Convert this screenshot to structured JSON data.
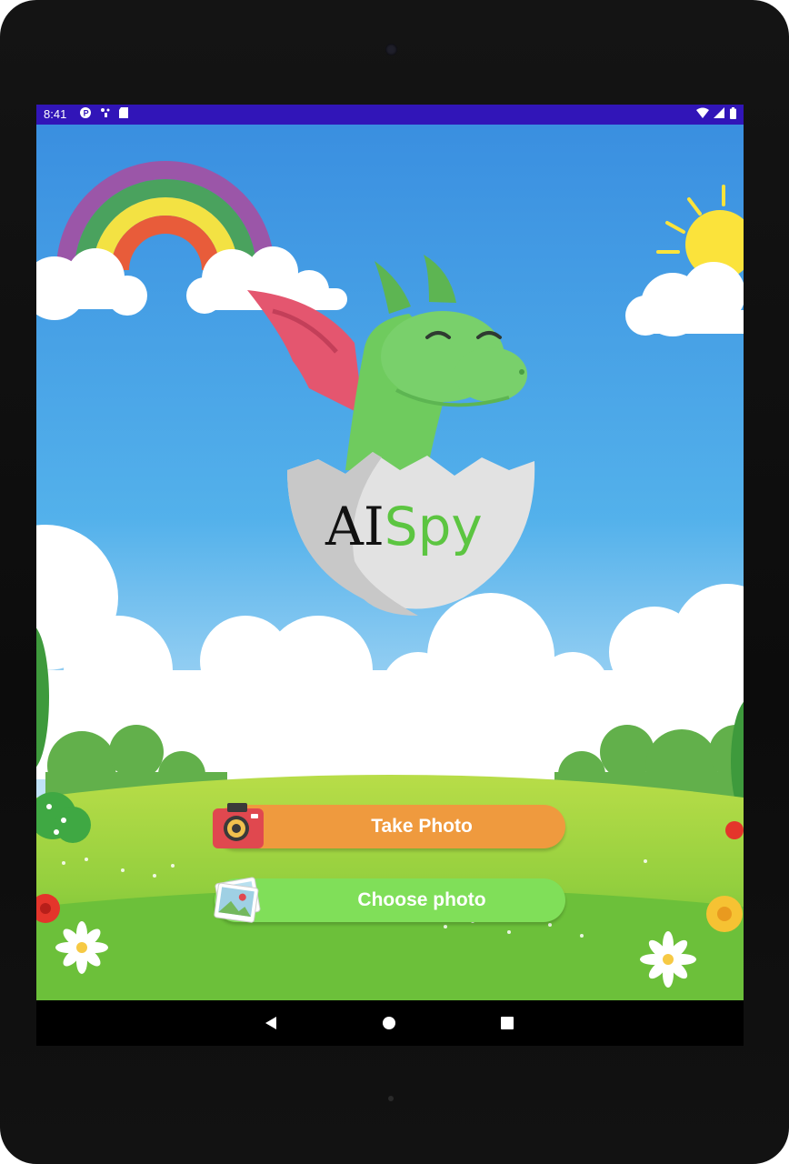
{
  "status_bar": {
    "time": "8:41",
    "left_icons": [
      "notification-icon",
      "cast-icon",
      "sd-card-icon"
    ],
    "right_icons": [
      "wifi-icon",
      "signal-icon",
      "battery-icon"
    ],
    "background_color": "#3115b8"
  },
  "app": {
    "logo": {
      "text_dark": "AI",
      "text_green": "Spy"
    },
    "buttons": {
      "take_photo": {
        "label": "Take Photo",
        "icon": "camera-icon",
        "color": "#ef9a3e"
      },
      "choose_photo": {
        "label": "Choose photo",
        "icon": "photos-icon",
        "color": "#80df59"
      }
    }
  },
  "nav_bar": {
    "back": "back-icon",
    "home": "home-icon",
    "recents": "recents-icon"
  },
  "colors": {
    "sky_top": "#3a8fe0",
    "sky_bottom": "#d8ecfa",
    "grass": "#8ccf3c",
    "dragon_green": "#6fcb5e",
    "wing_pink": "#e4566f"
  }
}
